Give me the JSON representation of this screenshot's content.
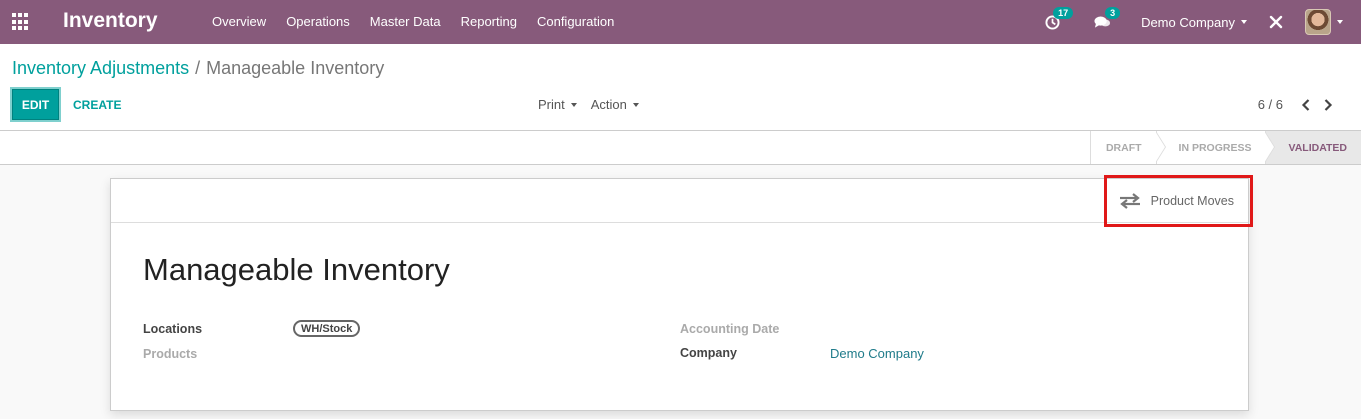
{
  "navbar": {
    "app_title": "Inventory",
    "menu": [
      "Overview",
      "Operations",
      "Master Data",
      "Reporting",
      "Configuration"
    ],
    "activity_badge": "17",
    "messages_badge": "3",
    "company": "Demo Company",
    "color": "#875a7b"
  },
  "breadcrumb": {
    "parent": "Inventory Adjustments",
    "separator": "/",
    "current": "Manageable Inventory"
  },
  "toolbar": {
    "edit_label": "EDIT",
    "create_label": "CREATE",
    "print_label": "Print",
    "action_label": "Action"
  },
  "pager": {
    "value": "6 / 6"
  },
  "statusbar": {
    "stages": [
      "DRAFT",
      "IN PROGRESS",
      "VALIDATED"
    ],
    "active": "VALIDATED"
  },
  "smart_button": {
    "label": "Product Moves",
    "icon": "arrows-exchange-icon"
  },
  "form": {
    "title": "Manageable Inventory",
    "locations_label": "Locations",
    "locations_tag": "WH/Stock",
    "products_label": "Products",
    "accounting_date_label": "Accounting Date",
    "company_label": "Company",
    "company_value": "Demo Company"
  },
  "colors": {
    "accent": "#00a09d",
    "highlight": "#e01818"
  }
}
